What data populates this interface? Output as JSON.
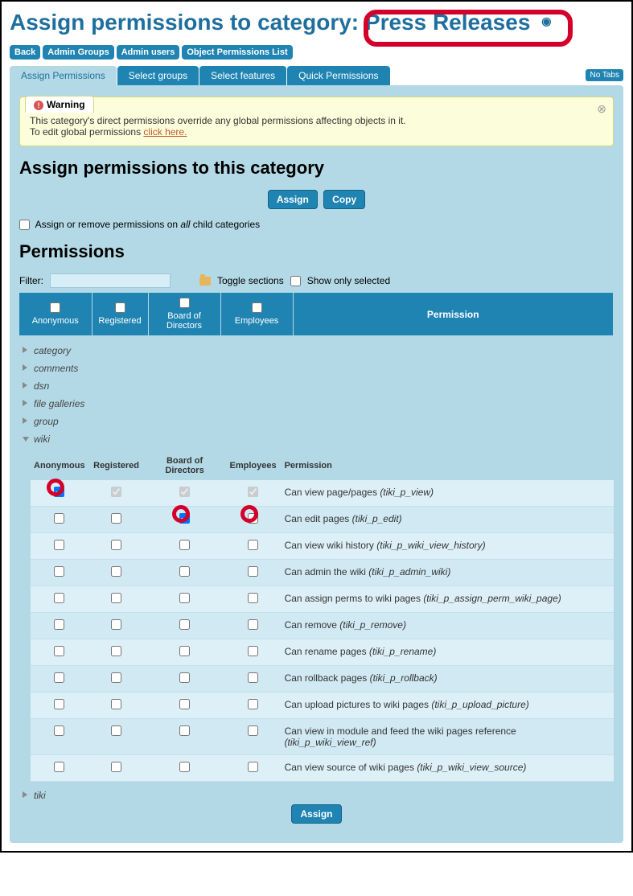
{
  "page_title_prefix": "Assign permissions to category: ",
  "page_title_name": "Press Releases",
  "nav_buttons": [
    "Back",
    "Admin Groups",
    "Admin users",
    "Object Permissions List"
  ],
  "tabs": [
    "Assign Permissions",
    "Select groups",
    "Select features",
    "Quick Permissions"
  ],
  "active_tab": 0,
  "no_tabs_label": "No Tabs",
  "warning": {
    "label": "Warning",
    "line1": "This category's direct permissions override any global permissions affecting objects in it.",
    "line2_prefix": "To edit global permissions ",
    "line2_link": "click here."
  },
  "section_heading": "Assign permissions to this category",
  "btn_assign": "Assign",
  "btn_copy": "Copy",
  "child_checkbox_label_pre": "Assign or remove permissions on ",
  "child_checkbox_label_em": "all",
  "child_checkbox_label_post": " child categories",
  "permissions_heading": "Permissions",
  "filter_label": "Filter:",
  "toggle_sections": "Toggle sections",
  "show_only_selected": "Show only selected",
  "header_groups": [
    "Anonymous",
    "Registered",
    "Board of Directors",
    "Employees"
  ],
  "header_permission": "Permission",
  "sections_collapsed": [
    "category",
    "comments",
    "dsn",
    "file galleries",
    "group"
  ],
  "section_expanded": "wiki",
  "sections_after": [
    "tiki"
  ],
  "wiki_table_headers": [
    "Anonymous",
    "Registered",
    "Board of Directors",
    "Employees",
    "Permission"
  ],
  "wiki_rows": [
    {
      "anon": {
        "checked": true,
        "disabled": false
      },
      "reg": {
        "checked": true,
        "disabled": true
      },
      "bod": {
        "checked": true,
        "disabled": true
      },
      "emp": {
        "checked": true,
        "disabled": true
      },
      "desc": "Can view page/pages",
      "code": "(tiki_p_view)",
      "circle_anon": true,
      "circle_bod": false,
      "circle_emp": false
    },
    {
      "anon": {
        "checked": false,
        "disabled": false
      },
      "reg": {
        "checked": false,
        "disabled": false
      },
      "bod": {
        "checked": true,
        "disabled": false
      },
      "emp": {
        "checked": false,
        "disabled": false
      },
      "desc": "Can edit pages",
      "code": "(tiki_p_edit)",
      "circle_anon": false,
      "circle_bod": true,
      "circle_emp": true
    },
    {
      "anon": {
        "checked": false,
        "disabled": false
      },
      "reg": {
        "checked": false,
        "disabled": false
      },
      "bod": {
        "checked": false,
        "disabled": false
      },
      "emp": {
        "checked": false,
        "disabled": false
      },
      "desc": "Can view wiki history",
      "code": "(tiki_p_wiki_view_history)"
    },
    {
      "anon": {
        "checked": false,
        "disabled": false
      },
      "reg": {
        "checked": false,
        "disabled": false
      },
      "bod": {
        "checked": false,
        "disabled": false
      },
      "emp": {
        "checked": false,
        "disabled": false
      },
      "desc": "Can admin the wiki",
      "code": "(tiki_p_admin_wiki)"
    },
    {
      "anon": {
        "checked": false,
        "disabled": false
      },
      "reg": {
        "checked": false,
        "disabled": false
      },
      "bod": {
        "checked": false,
        "disabled": false
      },
      "emp": {
        "checked": false,
        "disabled": false
      },
      "desc": "Can assign perms to wiki pages",
      "code": "(tiki_p_assign_perm_wiki_page)"
    },
    {
      "anon": {
        "checked": false,
        "disabled": false
      },
      "reg": {
        "checked": false,
        "disabled": false
      },
      "bod": {
        "checked": false,
        "disabled": false
      },
      "emp": {
        "checked": false,
        "disabled": false
      },
      "desc": "Can remove",
      "code": "(tiki_p_remove)"
    },
    {
      "anon": {
        "checked": false,
        "disabled": false
      },
      "reg": {
        "checked": false,
        "disabled": false
      },
      "bod": {
        "checked": false,
        "disabled": false
      },
      "emp": {
        "checked": false,
        "disabled": false
      },
      "desc": "Can rename pages",
      "code": "(tiki_p_rename)"
    },
    {
      "anon": {
        "checked": false,
        "disabled": false
      },
      "reg": {
        "checked": false,
        "disabled": false
      },
      "bod": {
        "checked": false,
        "disabled": false
      },
      "emp": {
        "checked": false,
        "disabled": false
      },
      "desc": "Can rollback pages",
      "code": "(tiki_p_rollback)"
    },
    {
      "anon": {
        "checked": false,
        "disabled": false
      },
      "reg": {
        "checked": false,
        "disabled": false
      },
      "bod": {
        "checked": false,
        "disabled": false
      },
      "emp": {
        "checked": false,
        "disabled": false
      },
      "desc": "Can upload pictures to wiki pages",
      "code": "(tiki_p_upload_picture)"
    },
    {
      "anon": {
        "checked": false,
        "disabled": false
      },
      "reg": {
        "checked": false,
        "disabled": false
      },
      "bod": {
        "checked": false,
        "disabled": false
      },
      "emp": {
        "checked": false,
        "disabled": false
      },
      "desc": "Can view in module and feed the wiki pages reference",
      "code": "(tiki_p_wiki_view_ref)"
    },
    {
      "anon": {
        "checked": false,
        "disabled": false
      },
      "reg": {
        "checked": false,
        "disabled": false
      },
      "bod": {
        "checked": false,
        "disabled": false
      },
      "emp": {
        "checked": false,
        "disabled": false
      },
      "desc": "Can view source of wiki pages",
      "code": "(tiki_p_wiki_view_source)"
    }
  ],
  "btn_assign_bottom": "Assign"
}
